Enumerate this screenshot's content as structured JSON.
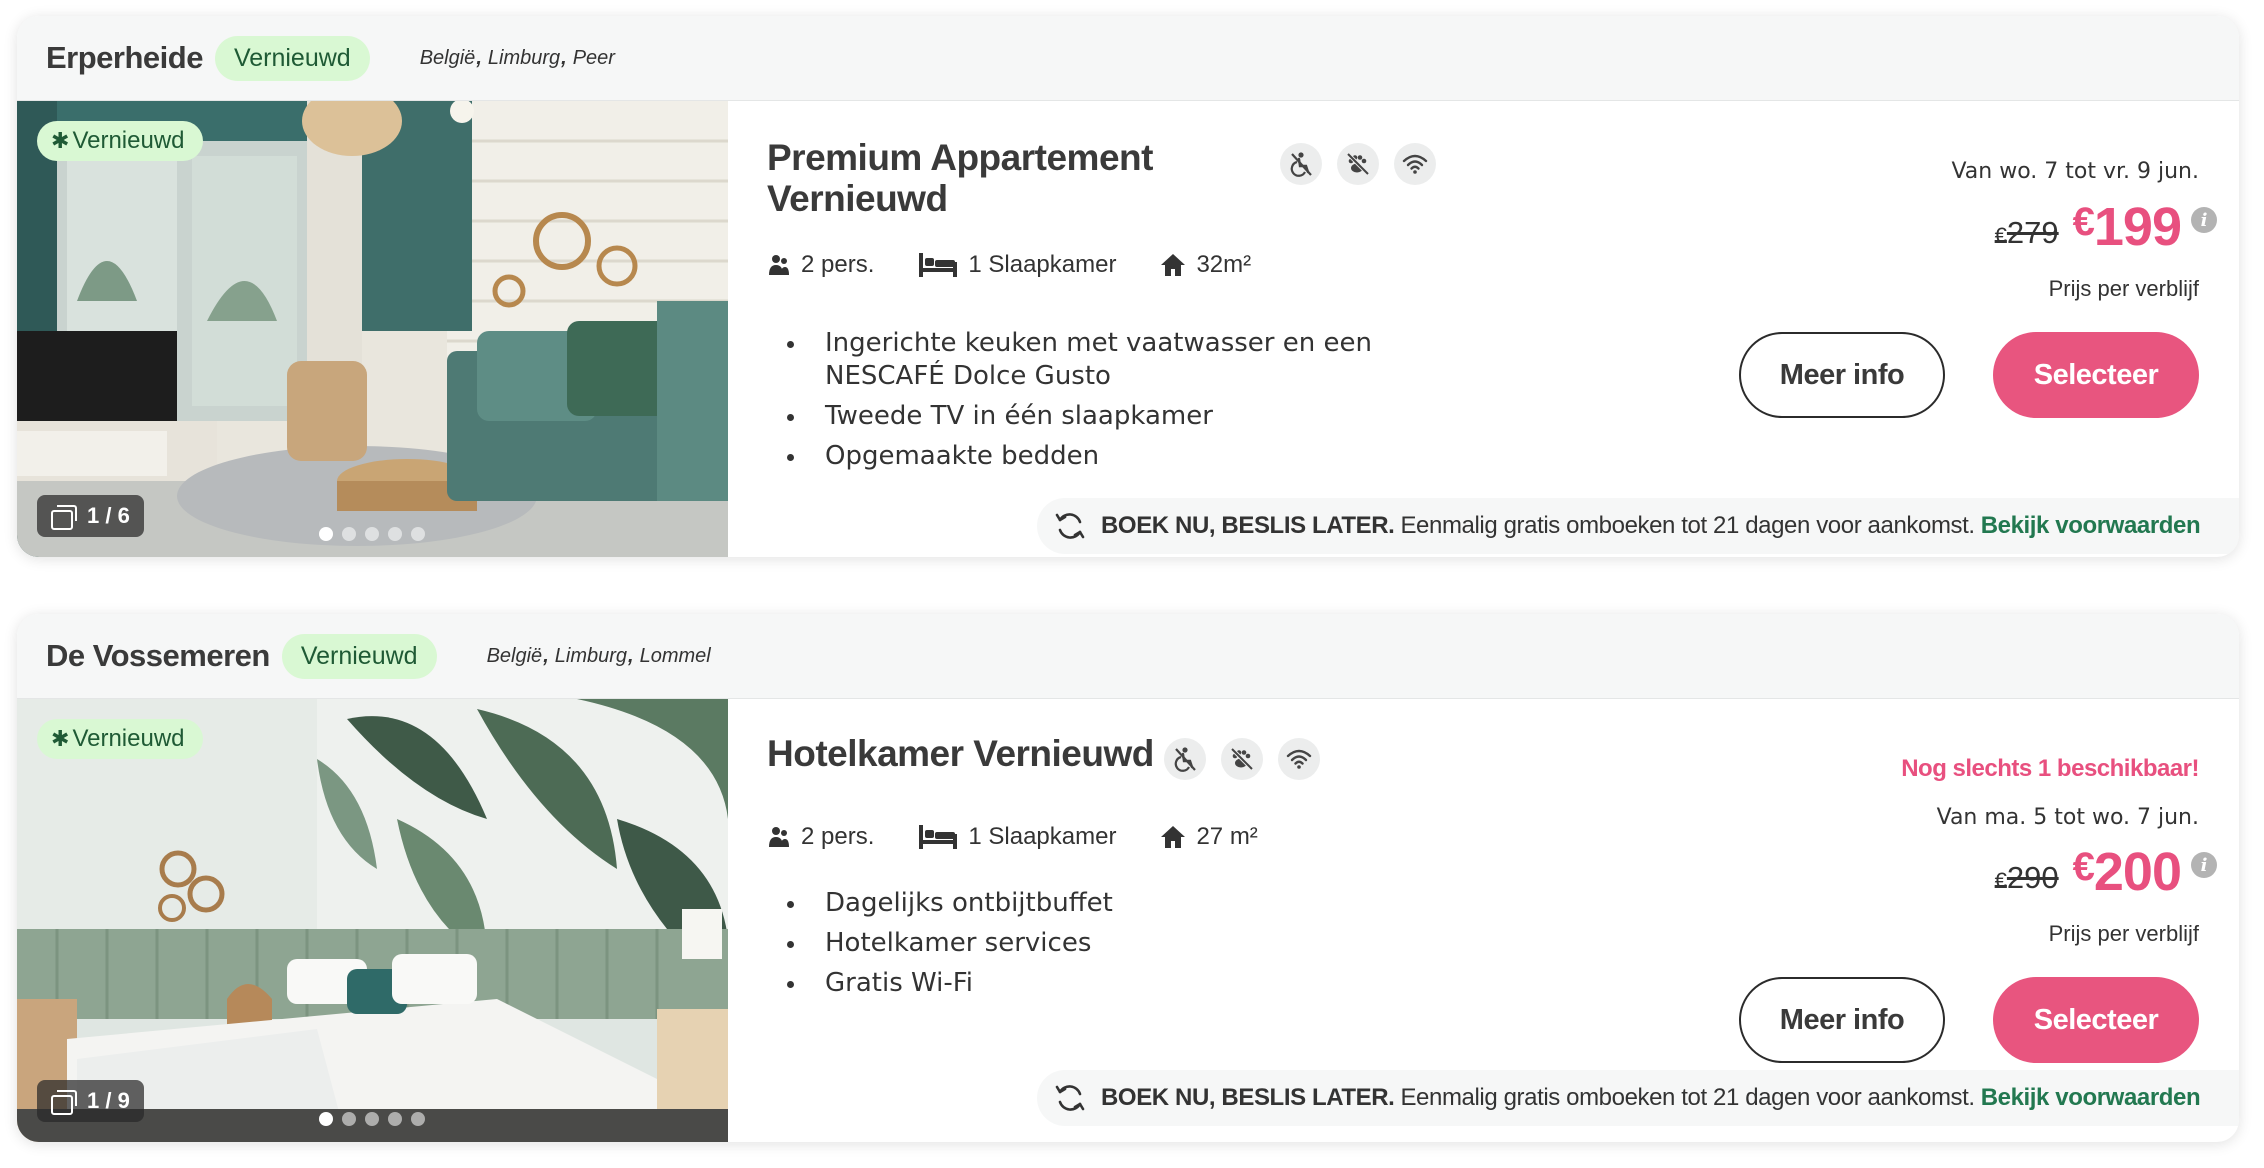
{
  "listings": [
    {
      "park_name": "Erperheide",
      "header_badge": "Vernieuwd",
      "location": [
        "België",
        "Limburg",
        "Peer"
      ],
      "photo_badge": "Vernieuwd",
      "photo_counter": "1 / 6",
      "photo_dots": 5,
      "photo_dot_active": 0,
      "title": "Premium Appartement Vernieuwd",
      "amenity_icons": [
        "no-wheelchair-icon",
        "no-pets-icon",
        "wifi-icon"
      ],
      "persons": "2 pers.",
      "bedrooms": "1 Slaapkamer",
      "area": "32m²",
      "features": [
        "Ingerichte keuken met vaatwasser en een NESCAFÉ Dolce Gusto",
        "Tweede TV in één slaapkamer",
        "Opgemaakte bedden"
      ],
      "availability": "",
      "period": "Van wo. 7 tot vr. 9 jun.",
      "old_price": "279",
      "new_price": "199",
      "currency": "€",
      "price_note": "Prijs per verblijf",
      "more_info_label": "Meer info",
      "select_label": "Selecteer",
      "flex_bold": "BOEK NU, BESLIS LATER.",
      "flex_text": "Eenmalig gratis omboeken tot 21 dagen voor aankomst.",
      "flex_link": "Bekijk voorwaarden"
    },
    {
      "park_name": "De Vossemeren",
      "header_badge": "Vernieuwd",
      "location": [
        "België",
        "Limburg",
        "Lommel"
      ],
      "photo_badge": "Vernieuwd",
      "photo_counter": "1 / 9",
      "photo_dots": 5,
      "photo_dot_active": 0,
      "title": "Hotelkamer Vernieuwd",
      "amenity_icons": [
        "no-wheelchair-icon",
        "no-pets-icon",
        "wifi-icon"
      ],
      "persons": "2 pers.",
      "bedrooms": "1 Slaapkamer",
      "area": "27 m²",
      "features": [
        "Dagelijks ontbijtbuffet",
        "Hotelkamer services",
        "Gratis Wi-Fi"
      ],
      "availability": "Nog slechts 1 beschikbaar!",
      "period": "Van ma. 5 tot wo. 7 jun.",
      "old_price": "290",
      "new_price": "200",
      "currency": "€",
      "price_note": "Prijs per verblijf",
      "more_info_label": "Meer info",
      "select_label": "Selecteer",
      "flex_bold": "BOEK NU, BESLIS LATER.",
      "flex_text": "Eenmalig gratis omboeken tot 21 dagen voor aankomst.",
      "flex_link": "Bekijk voorwaarden"
    }
  ],
  "colors": {
    "accent_pink": "#e8507f",
    "badge_green_bg": "#d9f8d3",
    "badge_green_text": "#1f5a35",
    "link_green": "#227850"
  }
}
